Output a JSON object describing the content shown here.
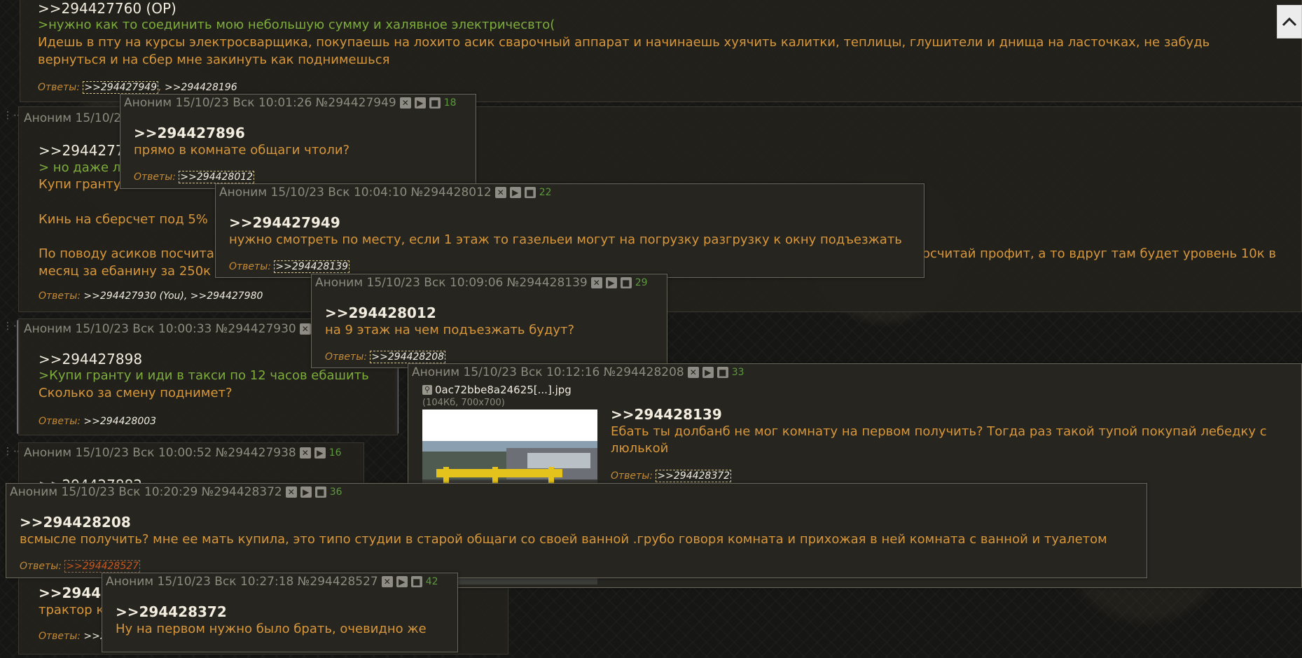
{
  "op_post": {
    "title": ">>294427760 (OP)",
    "quote": ">нужно как то соединить мою небольшую сумму и халявное электричесвто(",
    "text1": "Идешь в пту на курсы электросварщика, покупаешь на лохито асик сварочный аппарат и начинаешь хуячить калитки, теплицы, глушители и днища на ласточках, не забудь",
    "text2": "вернуться и на сбер мне закинуть как поднимешься",
    "answers_label": "Ответы:",
    "answer1": ">>294427949",
    "answer2": ">>294428196"
  },
  "post2": {
    "head": "Аноним 15/10/2",
    "ref": ">>29442776",
    "quote": "> но даже л",
    "line1": "Купи гранту",
    "line2": "Кинь на сберсчет под 5%",
    "line3a": "По поводу асиков посчита",
    "line3b": "осчитай профит, а то вдруг там будет уровень 10к в",
    "line4": "месяц за ебанину за 250к",
    "answers_label": "Ответы:",
    "answers_text": ">>294427930 (You), >>294427980"
  },
  "post3": {
    "head": "Аноним 15/10/23 Вск 10:00:33 №294427930",
    "ref": ">>294427898",
    "quote": ">Купи гранту и иди в такси по 12 часов ебашить",
    "text": "Сколько за смену поднимет?",
    "answers_label": "Ответы:",
    "answer": ">>294428003"
  },
  "post4": {
    "head": "Аноним 15/10/23 Вск 10:00:52 №294427938",
    "count": "16",
    "ref": ">>294427882"
  },
  "post5": {
    "ref": ">>29442",
    "text": "трактор к",
    "answers_label": "Ответы:",
    "answer": ">>29"
  },
  "popup1": {
    "head": "Аноним 15/10/23 Вск 10:01:26 №294427949",
    "count": "18",
    "ref": ">>294427896",
    "text": "прямо в комнате общаги чтоли?",
    "answers_label": "Ответы:",
    "answer": ">>294428012"
  },
  "popup2": {
    "head": "Аноним 15/10/23 Вск 10:04:10 №294428012",
    "count": "22",
    "ref": ">>294427949",
    "text": "нужно смотреть по месту, если 1 этаж то газельеи могут на погрузку разгрузку к окну подъезжать",
    "answers_label": "Ответы:",
    "answer": ">>294428139"
  },
  "popup3": {
    "head": "Аноним 15/10/23 Вск 10:09:06 №294428139",
    "count": "29",
    "ref": ">>294428012",
    "text": "на 9 этаж на чем подъезжать будут?",
    "answers_label": "Ответы:",
    "answer": ">>294428208"
  },
  "popup4": {
    "head": "Аноним 15/10/23 Вск 10:12:16 №294428208",
    "count": "33",
    "file_name": "0ac72bbe8a24625[...].jpg",
    "file_meta": "(104Кб, 700x700)",
    "ref": ">>294428139",
    "text1": "Ебать ты долбанб не мог комнату на первом получить? Тогда раз такой тупой покупай лебедку с",
    "text2": "люлькой",
    "answers_label": "Ответы:",
    "answer": ">>294428372"
  },
  "popup5": {
    "head": "Аноним 15/10/23 Вск 10:20:29 №294428372",
    "count": "36",
    "ref": ">>294428208",
    "text": "всмысле получить? мне ее мать купила, это типо студии в старой общаги со своей ванной .грубо говоря комната и прихожая в ней комната с ванной и туалетом",
    "answers_label": "Ответы:",
    "answer": ">>294428527"
  },
  "popup6": {
    "head": "Аноним 15/10/23 Вск 10:27:18 №294428527",
    "count": "42",
    "ref": ">>294428372",
    "text": "Ну на первом нужно было брать, очевидно же"
  },
  "colors": {
    "text": "#d8973a",
    "quote": "#7dad3b",
    "ref": "#f3ede0",
    "meta": "#8d8a7e",
    "count": "#5c9a3c",
    "highlight_link": "#c8571e"
  },
  "icons": [
    "close-icon",
    "play-icon",
    "stop-icon",
    "magnifier-icon",
    "chevron-up-icon"
  ]
}
